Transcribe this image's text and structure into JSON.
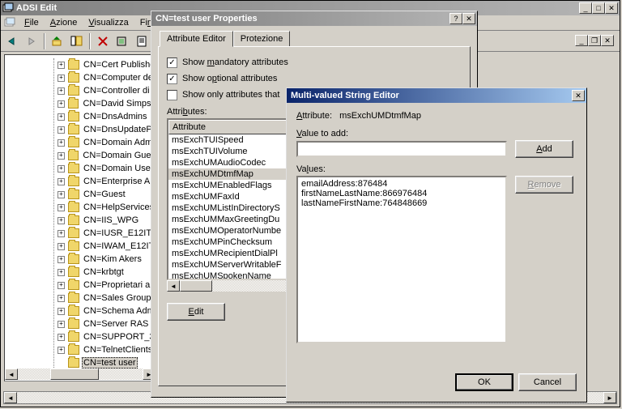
{
  "main_window": {
    "title": "ADSI Edit"
  },
  "menubar": {
    "file": "File",
    "actions": "Azione",
    "view": "Visualizza",
    "window": "Finestra",
    "help": "?"
  },
  "tree": {
    "items": [
      "CN=Cert Publishe",
      "CN=Computer de",
      "CN=Controller di",
      "CN=David Simpsc",
      "CN=DnsAdmins",
      "CN=DnsUpdateP",
      "CN=Domain Admi",
      "CN=Domain Gues",
      "CN=Domain User",
      "CN=Enterprise A",
      "CN=Guest",
      "CN=HelpServices",
      "CN=IIS_WPG",
      "CN=IUSR_E12IT",
      "CN=IWAM_E12IT",
      "CN=Kim Akers",
      "CN=krbtgt",
      "CN=Proprietari a",
      "CN=Sales Group",
      "CN=Schema Adm",
      "CN=Server RAS",
      "CN=SUPPORT_3",
      "CN=TelnetClients",
      "CN=test user"
    ],
    "selected_index": 23
  },
  "props_dialog": {
    "title": "CN=test user Properties",
    "tabs": {
      "attribute_editor": "Attribute Editor",
      "protection": "Protezione"
    },
    "show_mandatory": "Show mandatory attributes",
    "show_optional": "Show optional attributes",
    "show_only_values": "Show only attributes that",
    "attributes_label": "Attributes:",
    "column_header": "Attribute",
    "attributes": [
      "msExchTUISpeed",
      "msExchTUIVolume",
      "msExchUMAudioCodec",
      "msExchUMDtmfMap",
      "msExchUMEnabledFlags",
      "msExchUMFaxId",
      "msExchUMListInDirectoryS",
      "msExchUMMaxGreetingDu",
      "msExchUMOperatorNumbe",
      "msExchUMPinChecksum",
      "msExchUMRecipientDialPl",
      "msExchUMServerWritableF",
      "msExchUMSpokenName"
    ],
    "selected_attr_index": 3,
    "edit_btn": "Edit"
  },
  "editor_dialog": {
    "title": "Multi-valued String Editor",
    "attribute_label": "Attribute:",
    "attribute_value": "msExchUMDtmfMap",
    "value_to_add_label": "Value to add:",
    "value_to_add": "",
    "add_btn": "Add",
    "values_label": "Values:",
    "values": [
      "emailAddress:876484",
      "firstNameLastName:866976484",
      "lastNameFirstName:764848669"
    ],
    "remove_btn": "Remove",
    "ok_btn": "OK",
    "cancel_btn": "Cancel"
  }
}
